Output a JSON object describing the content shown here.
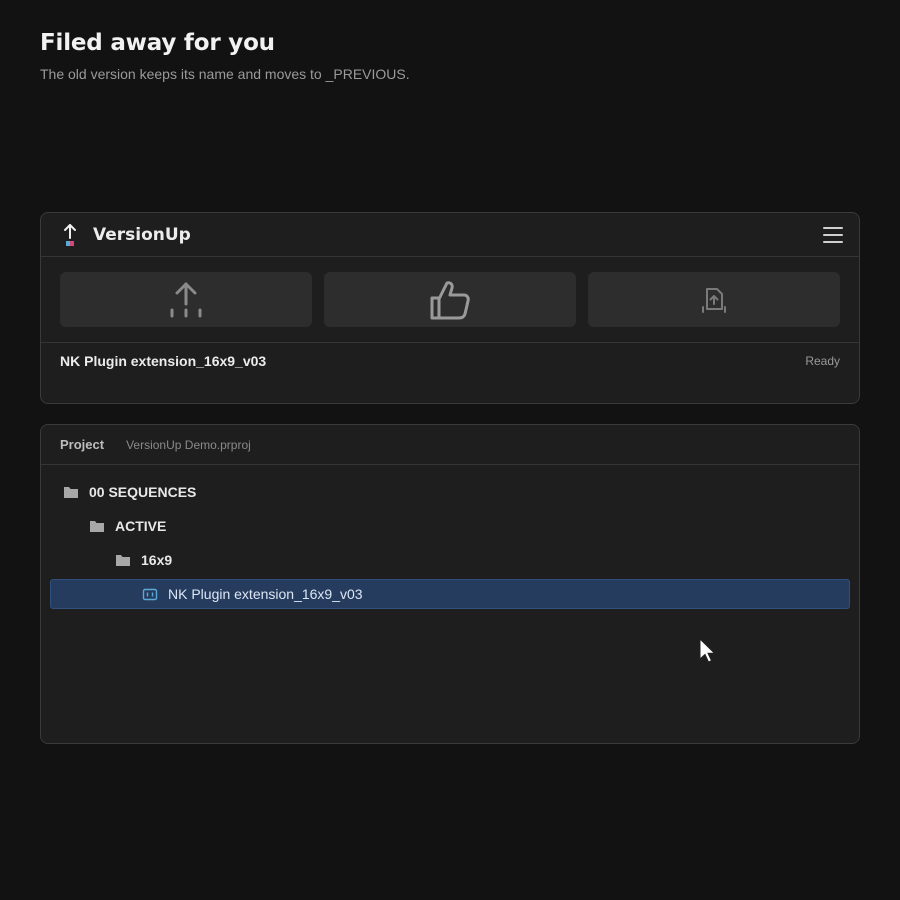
{
  "headline": {
    "title": "Filed away for you",
    "subtitle": "The old version keeps its name and moves to _PREVIOUS."
  },
  "app": {
    "title": "VersionUp",
    "logo_icon": "version-up-logo-icon",
    "menu_icon": "hamburger-menu-icon",
    "actions": [
      {
        "name": "version-up",
        "icon": "upload-arrow-icon"
      },
      {
        "name": "approve",
        "icon": "thumbs-up-icon"
      },
      {
        "name": "export",
        "icon": "file-upload-icon"
      }
    ],
    "status": {
      "current_name": "NK Plugin extension_16x9_v03",
      "state": "Ready"
    }
  },
  "project": {
    "label": "Project",
    "file": "VersionUp Demo.prproj",
    "tree": [
      {
        "label": "00 SEQUENCES",
        "type": "folder",
        "depth": 0
      },
      {
        "label": "ACTIVE",
        "type": "folder",
        "depth": 1
      },
      {
        "label": "16x9",
        "type": "folder",
        "depth": 2
      },
      {
        "label": "NK Plugin extension_16x9_v03",
        "type": "sequence",
        "depth": 3,
        "selected": true
      }
    ]
  },
  "colors": {
    "background": "#121212",
    "panel": "#1e1e1e",
    "selection": "#263c5e",
    "accent_blue": "#5aa9d6",
    "accent_pink": "#d6477a"
  }
}
